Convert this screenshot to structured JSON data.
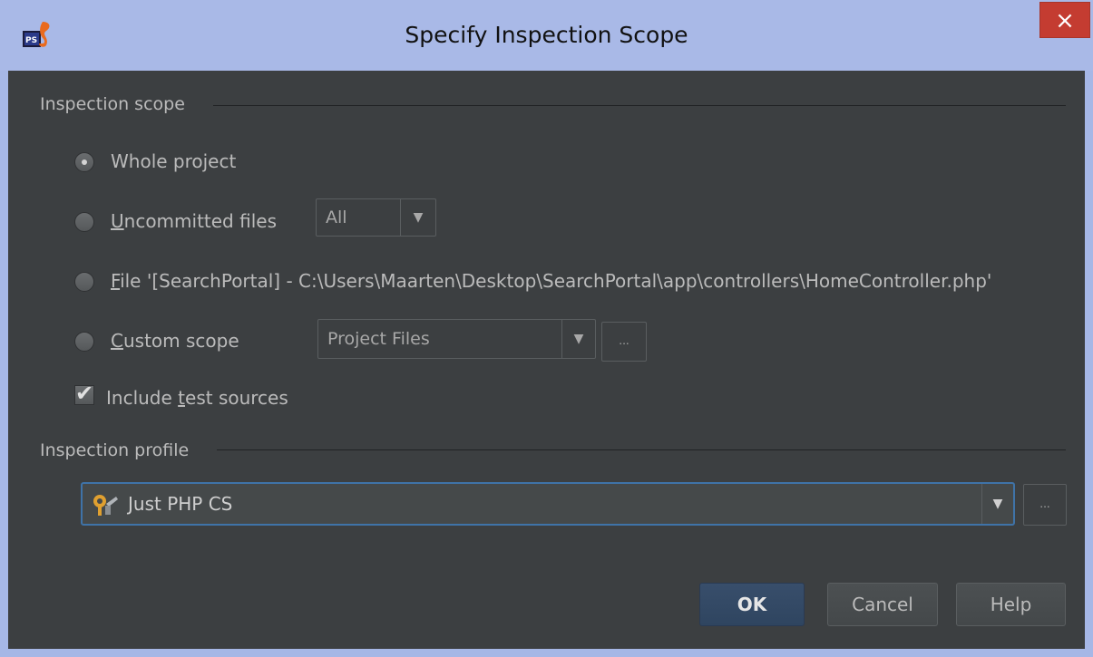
{
  "window": {
    "title": "Specify Inspection Scope",
    "close_label": "×"
  },
  "scope": {
    "section_label": "Inspection scope",
    "options": [
      {
        "label": "Whole project",
        "selected": true
      },
      {
        "label_mnemonic": "U",
        "label_rest": "ncommitted files",
        "selected": false
      },
      {
        "label_mnemonic": "F",
        "label_rest": "ile '[SearchPortal] - C:\\Users\\Maarten\\Desktop\\SearchPortal\\app\\controllers\\HomeController.php'",
        "selected": false
      },
      {
        "label_mnemonic": "C",
        "label_rest": "ustom scope",
        "selected": false
      }
    ],
    "uncommitted_combo": {
      "value": "All"
    },
    "custom_combo": {
      "value": "Project Files"
    },
    "ellipsis_label": "...",
    "include_tests": {
      "label_pre": "Include ",
      "label_mnemonic": "t",
      "label_rest": "est sources",
      "checked": true
    }
  },
  "profile": {
    "section_label": "Inspection profile",
    "value": "Just PHP CS",
    "ellipsis_label": "..."
  },
  "buttons": {
    "ok": "OK",
    "cancel": "Cancel",
    "help": "Help"
  },
  "colors": {
    "titlebar": "#a9b9e7",
    "dialog_background": "#3c3f41",
    "close_button": "#c43c31",
    "focus_border": "#3f73a8",
    "default_button": "#384e6b"
  }
}
